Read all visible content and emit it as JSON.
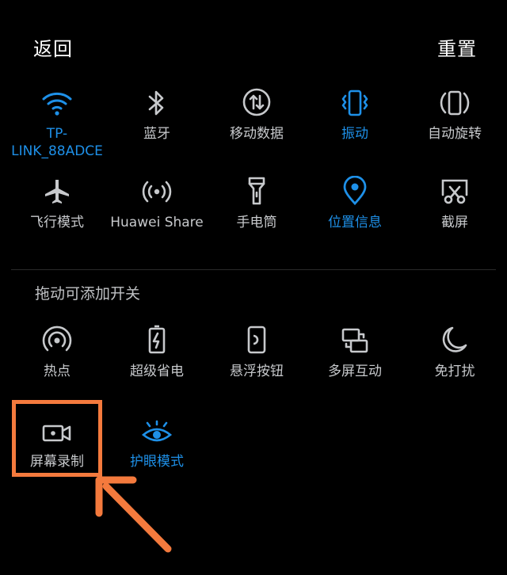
{
  "header": {
    "back_label": "返回",
    "reset_label": "重置"
  },
  "row1": [
    {
      "label": "TP-\nLINK_88ADCE",
      "icon": "wifi-icon",
      "active": true
    },
    {
      "label": "蓝牙",
      "icon": "bluetooth-icon",
      "active": false
    },
    {
      "label": "移动数据",
      "icon": "mobile-data-icon",
      "active": false
    },
    {
      "label": "振动",
      "icon": "vibrate-icon",
      "active": true
    },
    {
      "label": "自动旋转",
      "icon": "auto-rotate-icon",
      "active": false
    }
  ],
  "row2": [
    {
      "label": "飞行模式",
      "icon": "airplane-icon",
      "active": false
    },
    {
      "label": "Huawei Share",
      "icon": "huawei-share-icon",
      "active": false
    },
    {
      "label": "手电筒",
      "icon": "flashlight-icon",
      "active": false
    },
    {
      "label": "位置信息",
      "icon": "location-icon",
      "active": true
    },
    {
      "label": "截屏",
      "icon": "screenshot-icon",
      "active": false
    }
  ],
  "section": {
    "title": "拖动可添加开关"
  },
  "row3": [
    {
      "label": "热点",
      "icon": "hotspot-icon",
      "active": false
    },
    {
      "label": "超级省电",
      "icon": "battery-saver-icon",
      "active": false
    },
    {
      "label": "悬浮按钮",
      "icon": "floating-button-icon",
      "active": false
    },
    {
      "label": "多屏互动",
      "icon": "multi-screen-icon",
      "active": false
    },
    {
      "label": "免打扰",
      "icon": "do-not-disturb-icon",
      "active": false
    }
  ],
  "row4": [
    {
      "label": "屏幕录制",
      "icon": "screen-record-icon",
      "active": false
    },
    {
      "label": "护眼模式",
      "icon": "eye-comfort-icon",
      "active": true
    }
  ],
  "colors": {
    "accent": "#1e90e8",
    "text": "#c7c9cc",
    "highlight": "#f47a3d",
    "background": "#000000"
  }
}
